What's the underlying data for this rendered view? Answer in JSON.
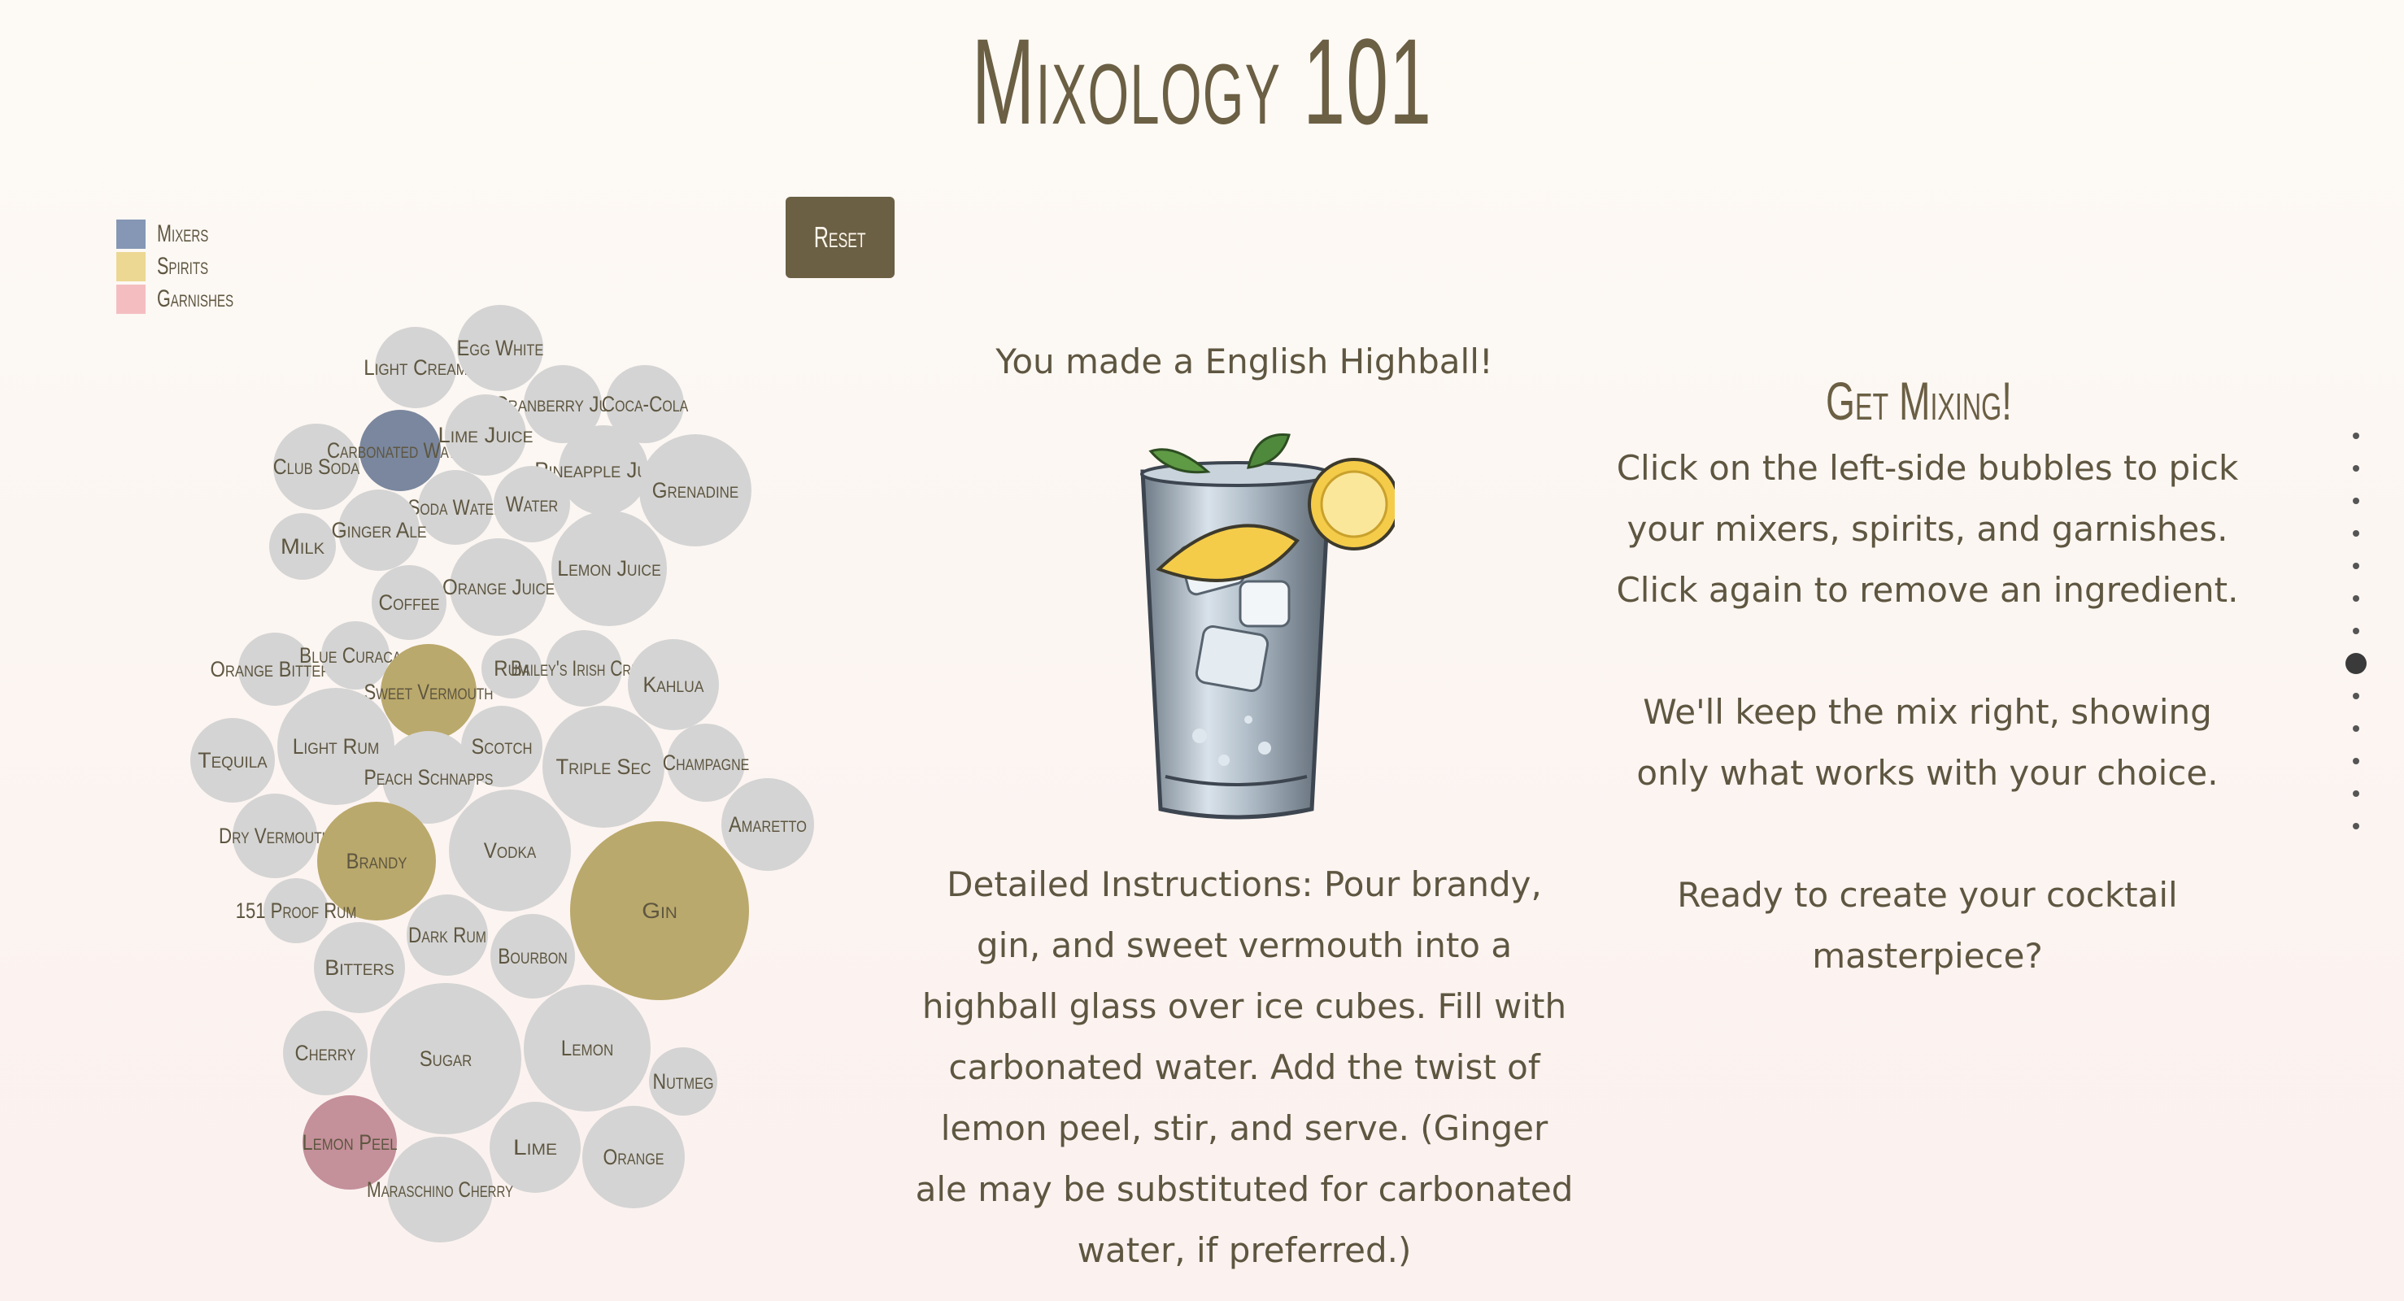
{
  "title": "Mixology 101",
  "legend": [
    {
      "label": "Mixers",
      "color": "#8597b4"
    },
    {
      "label": "Spirits",
      "color": "#ecd893"
    },
    {
      "label": "Garnishes",
      "color": "#f4bec1"
    }
  ],
  "reset_label": "Reset",
  "bubble_colors": {
    "default": "#d4d4d4",
    "mixer_selected": "#7a879e",
    "spirit_selected": "#baa96c",
    "garnish_selected": "#c4909a"
  },
  "bubbles": [
    {
      "label": "Light Cream",
      "group": "mixer",
      "selected": false
    },
    {
      "label": "Egg White",
      "group": "mixer",
      "selected": false
    },
    {
      "label": "Cranberry Juice",
      "group": "mixer",
      "selected": false
    },
    {
      "label": "Coca-Cola",
      "group": "mixer",
      "selected": false
    },
    {
      "label": "Club Soda",
      "group": "mixer",
      "selected": false
    },
    {
      "label": "Carbonated Water",
      "group": "mixer",
      "selected": true
    },
    {
      "label": "Lime Juice",
      "group": "mixer",
      "selected": false
    },
    {
      "label": "Pineapple Juice",
      "group": "mixer",
      "selected": false
    },
    {
      "label": "Grenadine",
      "group": "mixer",
      "selected": false
    },
    {
      "label": "Soda Water",
      "group": "mixer",
      "selected": false
    },
    {
      "label": "Water",
      "group": "mixer",
      "selected": false
    },
    {
      "label": "Milk",
      "group": "mixer",
      "selected": false
    },
    {
      "label": "Ginger Ale",
      "group": "mixer",
      "selected": false
    },
    {
      "label": "Lemon Juice",
      "group": "mixer",
      "selected": false
    },
    {
      "label": "Orange Juice",
      "group": "mixer",
      "selected": false
    },
    {
      "label": "Coffee",
      "group": "mixer",
      "selected": false
    },
    {
      "label": "Orange Bitters",
      "group": "mixer",
      "selected": false
    },
    {
      "label": "Blue Curacao",
      "group": "spirit",
      "selected": false
    },
    {
      "label": "Sweet Vermouth",
      "group": "spirit",
      "selected": true
    },
    {
      "label": "Rum",
      "group": "spirit",
      "selected": false
    },
    {
      "label": "Bailey's Irish Cream",
      "group": "spirit",
      "selected": false
    },
    {
      "label": "Kahlua",
      "group": "spirit",
      "selected": false
    },
    {
      "label": "Tequila",
      "group": "spirit",
      "selected": false
    },
    {
      "label": "Light Rum",
      "group": "spirit",
      "selected": false
    },
    {
      "label": "Scotch",
      "group": "spirit",
      "selected": false
    },
    {
      "label": "Peach Schnapps",
      "group": "spirit",
      "selected": false
    },
    {
      "label": "Triple Sec",
      "group": "spirit",
      "selected": false
    },
    {
      "label": "Champagne",
      "group": "spirit",
      "selected": false
    },
    {
      "label": "Amaretto",
      "group": "spirit",
      "selected": false
    },
    {
      "label": "Dry Vermouth",
      "group": "spirit",
      "selected": false
    },
    {
      "label": "Brandy",
      "group": "spirit",
      "selected": true
    },
    {
      "label": "Vodka",
      "group": "spirit",
      "selected": false
    },
    {
      "label": "Gin",
      "group": "spirit",
      "selected": true
    },
    {
      "label": "151 Proof Rum",
      "group": "spirit",
      "selected": false
    },
    {
      "label": "Dark Rum",
      "group": "spirit",
      "selected": false
    },
    {
      "label": "Bourbon",
      "group": "spirit",
      "selected": false
    },
    {
      "label": "Bitters",
      "group": "garnish",
      "selected": false
    },
    {
      "label": "Sugar",
      "group": "garnish",
      "selected": false
    },
    {
      "label": "Lemon",
      "group": "garnish",
      "selected": false
    },
    {
      "label": "Cherry",
      "group": "garnish",
      "selected": false
    },
    {
      "label": "Nutmeg",
      "group": "garnish",
      "selected": false
    },
    {
      "label": "Lemon Peel",
      "group": "garnish",
      "selected": true
    },
    {
      "label": "Lime",
      "group": "garnish",
      "selected": false
    },
    {
      "label": "Orange",
      "group": "garnish",
      "selected": false
    },
    {
      "label": "Maraschino Cherry",
      "group": "garnish",
      "selected": false
    }
  ],
  "result": {
    "made_text": "You made a English Highball!",
    "drink_icon": "highball-glass-icon",
    "instructions": "Detailed Instructions: Pour brandy, gin, and sweet vermouth into a highball glass over ice cubes. Fill with carbonated water. Add the twist of lemon peel, stir, and serve. (Ginger ale may be substituted for carbonated water, if preferred.)"
  },
  "get_mixing": {
    "title": "Get Mixing!",
    "p1": "Click on the left-side bubbles to pick your mixers, spirits, and garnishes. Click again to remove an ingredient.",
    "p2": "We'll keep the mix right, showing only what works with your choice.",
    "p3": "Ready to create your cocktail masterpiece?"
  },
  "pagination": {
    "count": 13,
    "active_index": 7
  }
}
